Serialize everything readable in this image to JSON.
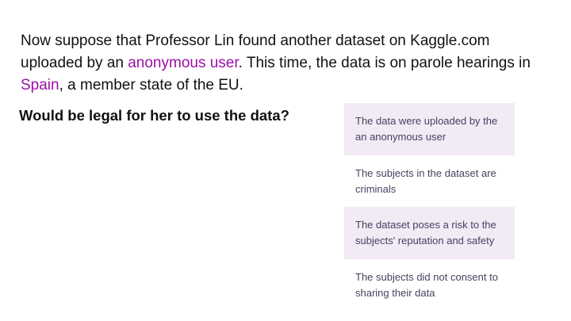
{
  "intro": {
    "text1": "Now suppose that Professor Lin found another dataset on Kaggle.com uploaded by an ",
    "highlight1": "anonymous user",
    "text2": ". This time, the data is on parole hearings in ",
    "highlight2": "Spain",
    "text3": ", a member state of the EU."
  },
  "question": "Would be legal for her to use the data?",
  "colors": {
    "highlight": "#9b10a6",
    "card_shade": "#f2eaf5",
    "card_text": "#4a4060"
  },
  "options": [
    {
      "text": "The data were uploaded by the an anonymous user"
    },
    {
      "text": "The subjects in the dataset are criminals"
    },
    {
      "text": "The dataset poses a risk to the subjects' reputation and safety"
    },
    {
      "text": "The subjects did not consent to sharing their data"
    }
  ]
}
